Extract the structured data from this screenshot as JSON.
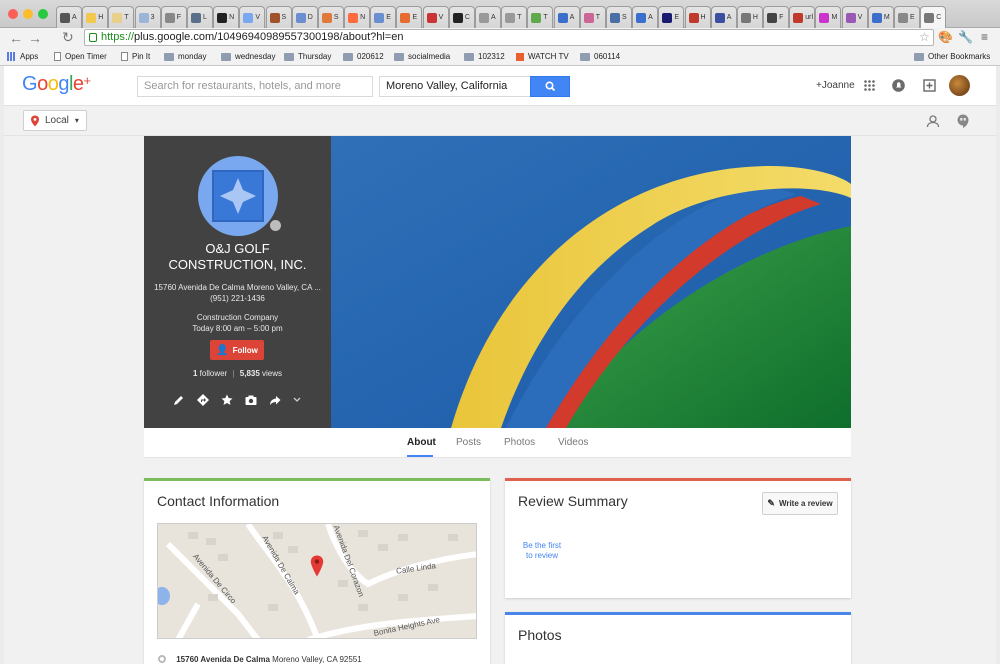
{
  "browser": {
    "tabs": [
      "A",
      "H",
      "T",
      "3",
      "F",
      "L",
      "N",
      "V",
      "S",
      "D",
      "S",
      "N",
      "E",
      "E",
      "V",
      "C",
      "A",
      "T",
      "T",
      "A",
      "T",
      "S",
      "A",
      "E",
      "H",
      "A",
      "H",
      "F",
      "url",
      "M",
      "V",
      "M",
      "E",
      "C"
    ],
    "url_scheme": "https://",
    "url_rest": "plus.google.com/104969409895573001​98/about?hl=en",
    "bookmarks": [
      "Apps",
      "Open Timer",
      "Pin It",
      "monday",
      "wednesday",
      "Thursday",
      "020612",
      "socialmedia",
      "102312",
      "WATCH TV",
      "060114"
    ],
    "other_bookmarks": "Other Bookmarks"
  },
  "header": {
    "logo_text": "Google",
    "logo_plus": "+",
    "search_placeholder": "Search for restaurants, hotels, and more",
    "location_value": "Moreno Valley, California",
    "user_label": "+Joanne",
    "local_label": "Local"
  },
  "profile": {
    "name": "O&J GOLF CONSTRUCTION, INC.",
    "address": "15760 Avenida De Calma Moreno Valley, CA ...",
    "phone": "(951) 221-1436",
    "category": "Construction Company",
    "hours": "Today 8:00 am – 5:00 pm",
    "follow_label": "Follow",
    "followers_count": "1",
    "followers_label": "follower",
    "views_count": "5,835",
    "views_label": "views"
  },
  "page_tabs": [
    "About",
    "Posts",
    "Photos",
    "Videos"
  ],
  "contact": {
    "title": "Contact Information",
    "map_streets": [
      "Avenida De Circo",
      "Avenida De Calma",
      "Avenida Del Corazon",
      "Calle Linda",
      "Bonita Heights Ave"
    ],
    "address_bold": "15760 Avenida De Calma",
    "address_rest": "Moreno Valley, CA 92551"
  },
  "review": {
    "title": "Review Summary",
    "write_label": "Write a review",
    "be_first": "Be the first to review"
  },
  "photos": {
    "title": "Photos"
  },
  "colors": {
    "accent_blue": "#4285f4",
    "follow_red": "#db4437",
    "profile_bg": "#424242",
    "contact_bar": "#7cbb5c",
    "review_bar": "#e06050"
  }
}
